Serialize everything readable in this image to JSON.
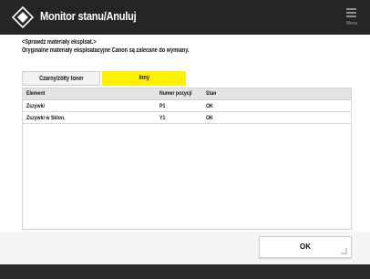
{
  "header": {
    "title": "Monitor stanu/Anuluj",
    "menu_label": "Menu"
  },
  "message": {
    "line1": "<Sprawdź materiały eksploat.>",
    "line2": "Oryginalne materiały eksploatacyjne Canon są zalecane do wymiany."
  },
  "tabs": [
    {
      "label": "Czarny/żółty toner",
      "selected": false
    },
    {
      "label": "Inny",
      "selected": true
    }
  ],
  "table": {
    "headers": {
      "name": "Element",
      "position": "Numer pozycji",
      "status": "Stan"
    },
    "rows": [
      {
        "name": "Zszywki",
        "position": "P1",
        "status": "OK"
      },
      {
        "name": "Zszywki w Sklon.",
        "position": "Y1",
        "status": "OK"
      }
    ]
  },
  "ok_button": {
    "label": "OK"
  },
  "icons": {
    "logo": "diamond-logo-icon",
    "menu": "menu-icon",
    "resize": "corner-mark-icon"
  },
  "colors": {
    "titlebar": "#252525",
    "selected_tab": "#ffef00",
    "table_header": "#e4e4e4"
  }
}
